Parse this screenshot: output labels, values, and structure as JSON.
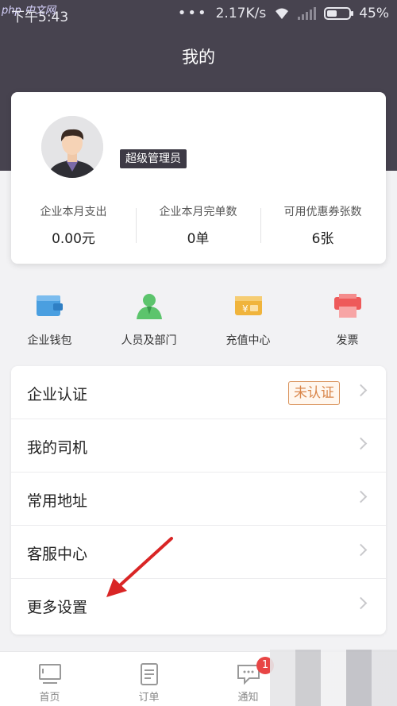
{
  "status_bar": {
    "watermark": "php 中文网",
    "time": "下午5:43",
    "network_speed": "2.17K/s",
    "battery": "45%"
  },
  "header": {
    "title": "我的"
  },
  "profile": {
    "role": "超级管理员",
    "stats": [
      {
        "label": "企业本月支出",
        "value": "0.00元"
      },
      {
        "label": "企业本月完单数",
        "value": "0单"
      },
      {
        "label": "可用优惠券张数",
        "value": "6张"
      }
    ]
  },
  "quick_entries": [
    {
      "label": "企业钱包",
      "icon": "wallet-icon",
      "color": "#4a9fe0"
    },
    {
      "label": "人员及部门",
      "icon": "people-icon",
      "color": "#5cc46c"
    },
    {
      "label": "充值中心",
      "icon": "recharge-icon",
      "color": "#f0b43c"
    },
    {
      "label": "发票",
      "icon": "invoice-icon",
      "color": "#ee5a5a"
    }
  ],
  "menu": {
    "items": [
      {
        "label": "企业认证",
        "badge": "未认证"
      },
      {
        "label": "我的司机"
      },
      {
        "label": "常用地址"
      },
      {
        "label": "客服中心"
      },
      {
        "label": "更多设置"
      }
    ]
  },
  "tabbar": {
    "tabs": [
      {
        "label": "首页",
        "icon": "home-screen-icon"
      },
      {
        "label": "订单",
        "icon": "order-icon"
      },
      {
        "label": "通知",
        "icon": "message-icon",
        "badge": "1"
      }
    ]
  },
  "colors": {
    "header_bg": "#47434f",
    "badge_orange": "#d9864a",
    "notification_red": "#e84545",
    "arrow_red": "#d92525"
  }
}
